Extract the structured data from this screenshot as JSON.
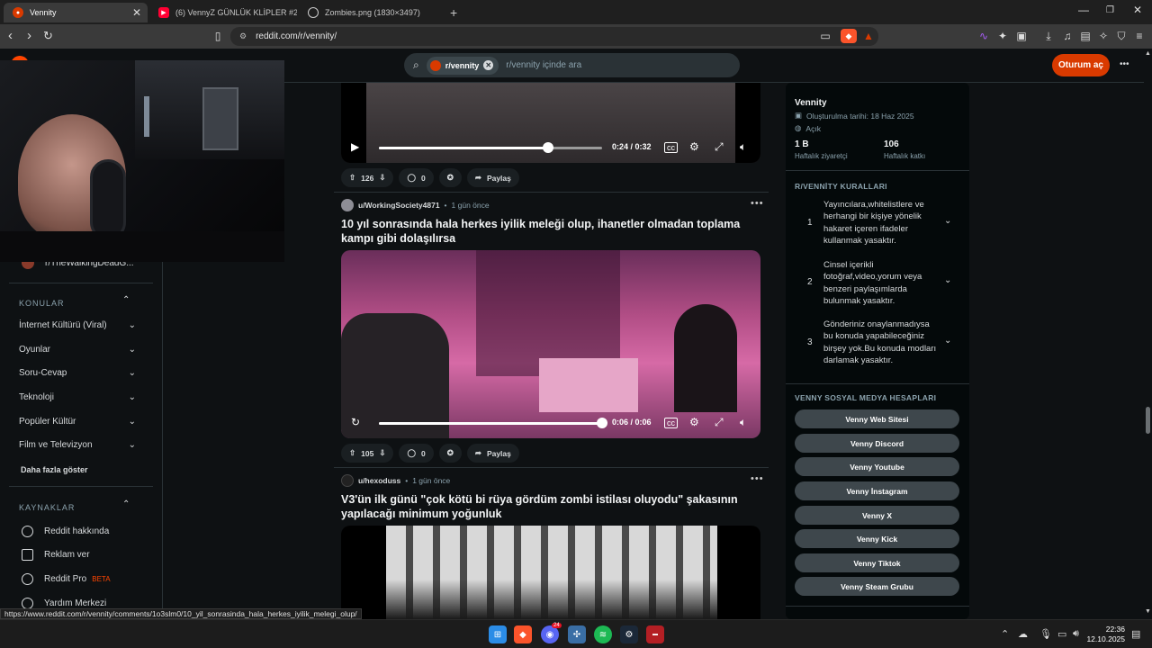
{
  "browser": {
    "tabs": [
      {
        "title": "Vennity",
        "active": true
      },
      {
        "title": "(6) VennyZ GÜNLÜK KLİPLER #2 - Ve",
        "active": false
      },
      {
        "title": "Zombies.png (1830×3497)",
        "active": false
      }
    ],
    "new_tab": "+",
    "url": "reddit.com/r/vennity/",
    "status_url": "https://www.reddit.com/r/vennity/comments/1o3slm0/10_yil_sonrasinda_hala_herkes_iyilik_melegi_olup/"
  },
  "header": {
    "search_chip": "r/vennity",
    "search_placeholder": "r/vennity içinde ara",
    "login_label": "Oturum aç",
    "more_label": "•••"
  },
  "leftnav": {
    "recent_item": "r/TheWalkingDeadG...",
    "topics_label": "KONULAR",
    "topics": [
      "İnternet Kültürü (Viral)",
      "Oyunlar",
      "Soru-Cevap",
      "Teknoloji",
      "Popüler Kültür",
      "Film ve Televizyon"
    ],
    "show_more": "Daha fazla göster",
    "resources_label": "KAYNAKLAR",
    "resources": [
      {
        "label": "Reddit hakkında",
        "badge": ""
      },
      {
        "label": "Reklam ver",
        "badge": ""
      },
      {
        "label": "Reddit Pro",
        "badge": "BETA"
      },
      {
        "label": "Yardım Merkezi",
        "badge": ""
      }
    ]
  },
  "posts": [
    {
      "video": {
        "time": "0:24 / 0:32",
        "progress": 0.76
      },
      "votes": "126",
      "comments": "0",
      "share": "Paylaş"
    },
    {
      "user": "u/WorkingSociety4871",
      "age": "1 gün önce",
      "title": "10 yıl sonrasında hala herkes iyilik meleği olup, ihanetler olmadan toplama kampı gibi dolaşılırsa",
      "video": {
        "time": "0:06 / 0:06",
        "progress": 1.0
      },
      "votes": "105",
      "comments": "0",
      "share": "Paylaş"
    },
    {
      "user": "u/hexoduss",
      "age": "1 gün önce",
      "title": "V3'ün ilk günü \"çok kötü bi rüya gördüm zombi istilası oluyodu\" şakasının yapılacağı minimum yoğunluk"
    }
  ],
  "sidebar": {
    "name": "Vennity",
    "created": "Oluşturulma tarihi: 18 Haz 2025",
    "visibility": "Açık",
    "stats": [
      {
        "value": "1 B",
        "label": "Haftalık ziyaretçi"
      },
      {
        "value": "106",
        "label": "Haftalık katkı"
      }
    ],
    "rules_title": "R/VENNİTY KURALLARI",
    "rules": [
      {
        "num": "1",
        "text": "Yayıncılara,whitelistlere ve herhangi bir kişiye yönelik hakaret içeren ifadeler kullanmak yasaktır."
      },
      {
        "num": "2",
        "text": "Cinsel içerikli fotoğraf,video,yorum veya benzeri paylaşımlarda bulunmak yasaktır."
      },
      {
        "num": "3",
        "text": "Gönderiniz onaylanmadıysa bu konuda yapabileceğiniz birşey yok.Bu konuda modları darlamak yasaktır."
      }
    ],
    "social_title": "VENNY SOSYAL MEDYA HESAPLARI",
    "social": [
      "Venny Web Sitesi",
      "Venny Discord",
      "Venny Youtube",
      "Venny İnstagram",
      "Venny X",
      "Venny Kick",
      "Venny Tiktok",
      "Venny Steam Grubu"
    ]
  },
  "taskbar": {
    "time": "22:36",
    "date": "12.10.2025",
    "discord_badge": "24"
  },
  "colors": {
    "accent": "#d93a00",
    "bg": "#0e1113"
  }
}
